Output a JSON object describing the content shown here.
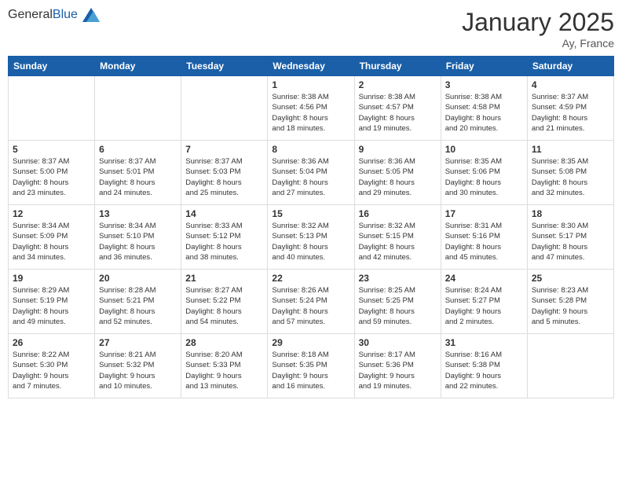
{
  "header": {
    "logo_general": "General",
    "logo_blue": "Blue",
    "month_year": "January 2025",
    "location": "Ay, France"
  },
  "weekdays": [
    "Sunday",
    "Monday",
    "Tuesday",
    "Wednesday",
    "Thursday",
    "Friday",
    "Saturday"
  ],
  "weeks": [
    [
      {
        "day": "",
        "info": ""
      },
      {
        "day": "",
        "info": ""
      },
      {
        "day": "",
        "info": ""
      },
      {
        "day": "1",
        "info": "Sunrise: 8:38 AM\nSunset: 4:56 PM\nDaylight: 8 hours\nand 18 minutes."
      },
      {
        "day": "2",
        "info": "Sunrise: 8:38 AM\nSunset: 4:57 PM\nDaylight: 8 hours\nand 19 minutes."
      },
      {
        "day": "3",
        "info": "Sunrise: 8:38 AM\nSunset: 4:58 PM\nDaylight: 8 hours\nand 20 minutes."
      },
      {
        "day": "4",
        "info": "Sunrise: 8:37 AM\nSunset: 4:59 PM\nDaylight: 8 hours\nand 21 minutes."
      }
    ],
    [
      {
        "day": "5",
        "info": "Sunrise: 8:37 AM\nSunset: 5:00 PM\nDaylight: 8 hours\nand 23 minutes."
      },
      {
        "day": "6",
        "info": "Sunrise: 8:37 AM\nSunset: 5:01 PM\nDaylight: 8 hours\nand 24 minutes."
      },
      {
        "day": "7",
        "info": "Sunrise: 8:37 AM\nSunset: 5:03 PM\nDaylight: 8 hours\nand 25 minutes."
      },
      {
        "day": "8",
        "info": "Sunrise: 8:36 AM\nSunset: 5:04 PM\nDaylight: 8 hours\nand 27 minutes."
      },
      {
        "day": "9",
        "info": "Sunrise: 8:36 AM\nSunset: 5:05 PM\nDaylight: 8 hours\nand 29 minutes."
      },
      {
        "day": "10",
        "info": "Sunrise: 8:35 AM\nSunset: 5:06 PM\nDaylight: 8 hours\nand 30 minutes."
      },
      {
        "day": "11",
        "info": "Sunrise: 8:35 AM\nSunset: 5:08 PM\nDaylight: 8 hours\nand 32 minutes."
      }
    ],
    [
      {
        "day": "12",
        "info": "Sunrise: 8:34 AM\nSunset: 5:09 PM\nDaylight: 8 hours\nand 34 minutes."
      },
      {
        "day": "13",
        "info": "Sunrise: 8:34 AM\nSunset: 5:10 PM\nDaylight: 8 hours\nand 36 minutes."
      },
      {
        "day": "14",
        "info": "Sunrise: 8:33 AM\nSunset: 5:12 PM\nDaylight: 8 hours\nand 38 minutes."
      },
      {
        "day": "15",
        "info": "Sunrise: 8:32 AM\nSunset: 5:13 PM\nDaylight: 8 hours\nand 40 minutes."
      },
      {
        "day": "16",
        "info": "Sunrise: 8:32 AM\nSunset: 5:15 PM\nDaylight: 8 hours\nand 42 minutes."
      },
      {
        "day": "17",
        "info": "Sunrise: 8:31 AM\nSunset: 5:16 PM\nDaylight: 8 hours\nand 45 minutes."
      },
      {
        "day": "18",
        "info": "Sunrise: 8:30 AM\nSunset: 5:17 PM\nDaylight: 8 hours\nand 47 minutes."
      }
    ],
    [
      {
        "day": "19",
        "info": "Sunrise: 8:29 AM\nSunset: 5:19 PM\nDaylight: 8 hours\nand 49 minutes."
      },
      {
        "day": "20",
        "info": "Sunrise: 8:28 AM\nSunset: 5:21 PM\nDaylight: 8 hours\nand 52 minutes."
      },
      {
        "day": "21",
        "info": "Sunrise: 8:27 AM\nSunset: 5:22 PM\nDaylight: 8 hours\nand 54 minutes."
      },
      {
        "day": "22",
        "info": "Sunrise: 8:26 AM\nSunset: 5:24 PM\nDaylight: 8 hours\nand 57 minutes."
      },
      {
        "day": "23",
        "info": "Sunrise: 8:25 AM\nSunset: 5:25 PM\nDaylight: 8 hours\nand 59 minutes."
      },
      {
        "day": "24",
        "info": "Sunrise: 8:24 AM\nSunset: 5:27 PM\nDaylight: 9 hours\nand 2 minutes."
      },
      {
        "day": "25",
        "info": "Sunrise: 8:23 AM\nSunset: 5:28 PM\nDaylight: 9 hours\nand 5 minutes."
      }
    ],
    [
      {
        "day": "26",
        "info": "Sunrise: 8:22 AM\nSunset: 5:30 PM\nDaylight: 9 hours\nand 7 minutes."
      },
      {
        "day": "27",
        "info": "Sunrise: 8:21 AM\nSunset: 5:32 PM\nDaylight: 9 hours\nand 10 minutes."
      },
      {
        "day": "28",
        "info": "Sunrise: 8:20 AM\nSunset: 5:33 PM\nDaylight: 9 hours\nand 13 minutes."
      },
      {
        "day": "29",
        "info": "Sunrise: 8:18 AM\nSunset: 5:35 PM\nDaylight: 9 hours\nand 16 minutes."
      },
      {
        "day": "30",
        "info": "Sunrise: 8:17 AM\nSunset: 5:36 PM\nDaylight: 9 hours\nand 19 minutes."
      },
      {
        "day": "31",
        "info": "Sunrise: 8:16 AM\nSunset: 5:38 PM\nDaylight: 9 hours\nand 22 minutes."
      },
      {
        "day": "",
        "info": ""
      }
    ]
  ]
}
